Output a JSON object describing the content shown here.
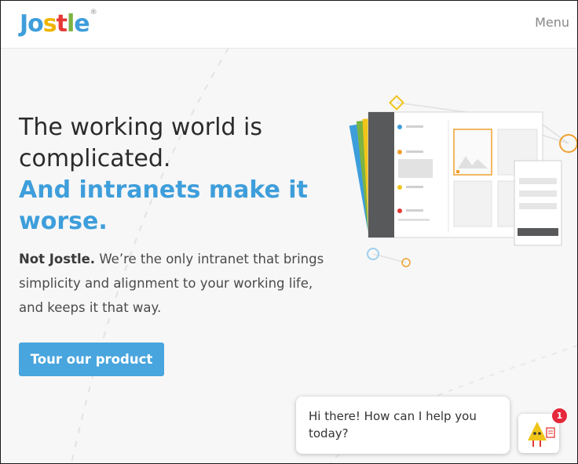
{
  "header": {
    "logo_letters": [
      "J",
      "o",
      "s",
      "t",
      "l",
      "e"
    ],
    "logo_colors": [
      "#3e9edb",
      "#3e9edb",
      "#f0b400",
      "#e53935",
      "#7cb342",
      "#3e9edb"
    ],
    "logo_reg": "®",
    "menu_label": "Menu"
  },
  "hero": {
    "title_line1": "The working world is complicated.",
    "title_line2": "And intranets make it worse.",
    "body_lead": "Not Jostle.",
    "body_text": " We’re the only intranet that brings simplicity and alignment to your working life, and keeps it that way.",
    "cta_label": "Tour our product"
  },
  "chat": {
    "greeting": "Hi there! How can I help you today?",
    "unread_count": "1"
  },
  "colors": {
    "accent": "#3e9edb",
    "button": "#48a5dd",
    "badge": "#e5283b",
    "illustration_orange": "#f0a030"
  }
}
